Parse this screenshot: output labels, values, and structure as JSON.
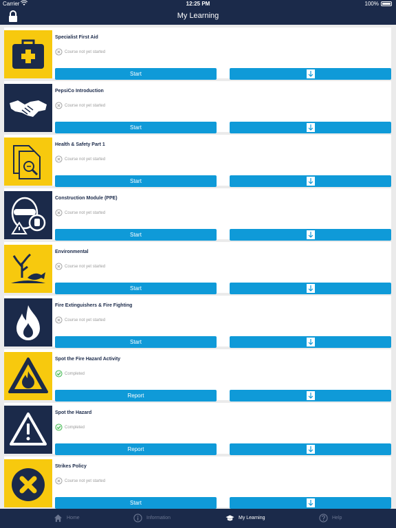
{
  "status_bar": {
    "carrier": "Carrier",
    "time": "12:25 PM",
    "battery": "100%"
  },
  "nav": {
    "title": "My Learning",
    "lock_icon": "lock-icon"
  },
  "courses": [
    {
      "title": "Specialist First Aid",
      "status": "Course not yet started",
      "action": "Start",
      "icon": "first-aid-kit-icon",
      "thumb_bg": "#f7c90e"
    },
    {
      "title": "PepsiCo Introduction",
      "status": "Course not yet started",
      "action": "Start",
      "icon": "handshake-icon",
      "thumb_bg": "#1b2a4a"
    },
    {
      "title": "Health & Safety Part 1",
      "status": "Course not yet started",
      "action": "Start",
      "icon": "document-search-icon",
      "thumb_bg": "#f7c90e"
    },
    {
      "title": "Construction Module (PPE)",
      "status": "Course not yet started",
      "action": "Start",
      "icon": "ppe-worker-icon",
      "thumb_bg": "#1b2a4a"
    },
    {
      "title": "Environmental",
      "status": "Course not yet started",
      "action": "Start",
      "icon": "environment-tree-fish-icon",
      "thumb_bg": "#f7c90e"
    },
    {
      "title": "Fire Extinguishers & Fire Fighting",
      "status": "Course not yet started",
      "action": "Start",
      "icon": "flame-icon",
      "thumb_bg": "#1b2a4a"
    },
    {
      "title": "Spot the Fire Hazard Activity",
      "status": "Completed",
      "action": "Report",
      "icon": "fire-hazard-triangle-icon",
      "thumb_bg": "#f7c90e"
    },
    {
      "title": "Spot the Hazard",
      "status": "Completed",
      "action": "Report",
      "icon": "warning-triangle-icon",
      "thumb_bg": "#1b2a4a"
    },
    {
      "title": "Strikes Policy",
      "status": "Course not yet started",
      "action": "Start",
      "icon": "cross-circle-icon",
      "thumb_bg": "#f7c90e"
    }
  ],
  "tabs": [
    {
      "label": "Home",
      "icon": "home-icon",
      "active": false
    },
    {
      "label": "Information",
      "icon": "info-icon",
      "active": false
    },
    {
      "label": "My Learning",
      "icon": "graduation-cap-icon",
      "active": true
    },
    {
      "label": "Help",
      "icon": "help-icon",
      "active": false
    }
  ],
  "colors": {
    "navy": "#1b2a4a",
    "accent_blue": "#0f9ad8",
    "yellow": "#f7c90e",
    "completed_green": "#3bb54a",
    "not_started_gray": "#9a9a9a"
  }
}
